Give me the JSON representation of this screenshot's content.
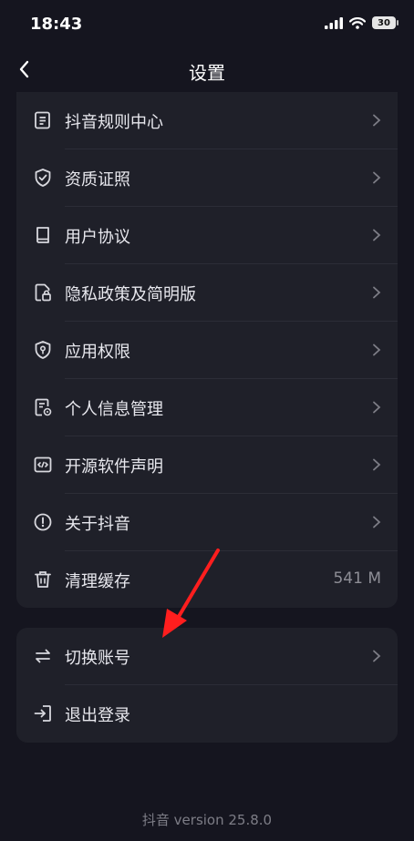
{
  "status": {
    "time": "18:43",
    "battery": "30"
  },
  "nav": {
    "title": "设置"
  },
  "menu_group_1": [
    {
      "label": "抖音规则中心",
      "icon": "document-list-icon"
    },
    {
      "label": "资质证照",
      "icon": "shield-check-icon"
    },
    {
      "label": "用户协议",
      "icon": "book-icon"
    },
    {
      "label": "隐私政策及简明版",
      "icon": "privacy-lock-icon"
    },
    {
      "label": "应用权限",
      "icon": "shield-key-icon"
    },
    {
      "label": "个人信息管理",
      "icon": "personal-info-icon"
    },
    {
      "label": "开源软件声明",
      "icon": "code-icon"
    },
    {
      "label": "关于抖音",
      "icon": "info-icon"
    },
    {
      "label": "清理缓存",
      "icon": "trash-icon",
      "value": "541 M"
    }
  ],
  "menu_group_2": [
    {
      "label": "切换账号",
      "icon": "swap-icon"
    },
    {
      "label": "退出登录",
      "icon": "logout-icon"
    }
  ],
  "footer": {
    "version_text": "抖音 version 25.8.0"
  },
  "colors": {
    "background": "#15151f",
    "card": "#1f2029",
    "annotation_arrow": "#ff1e1e"
  }
}
